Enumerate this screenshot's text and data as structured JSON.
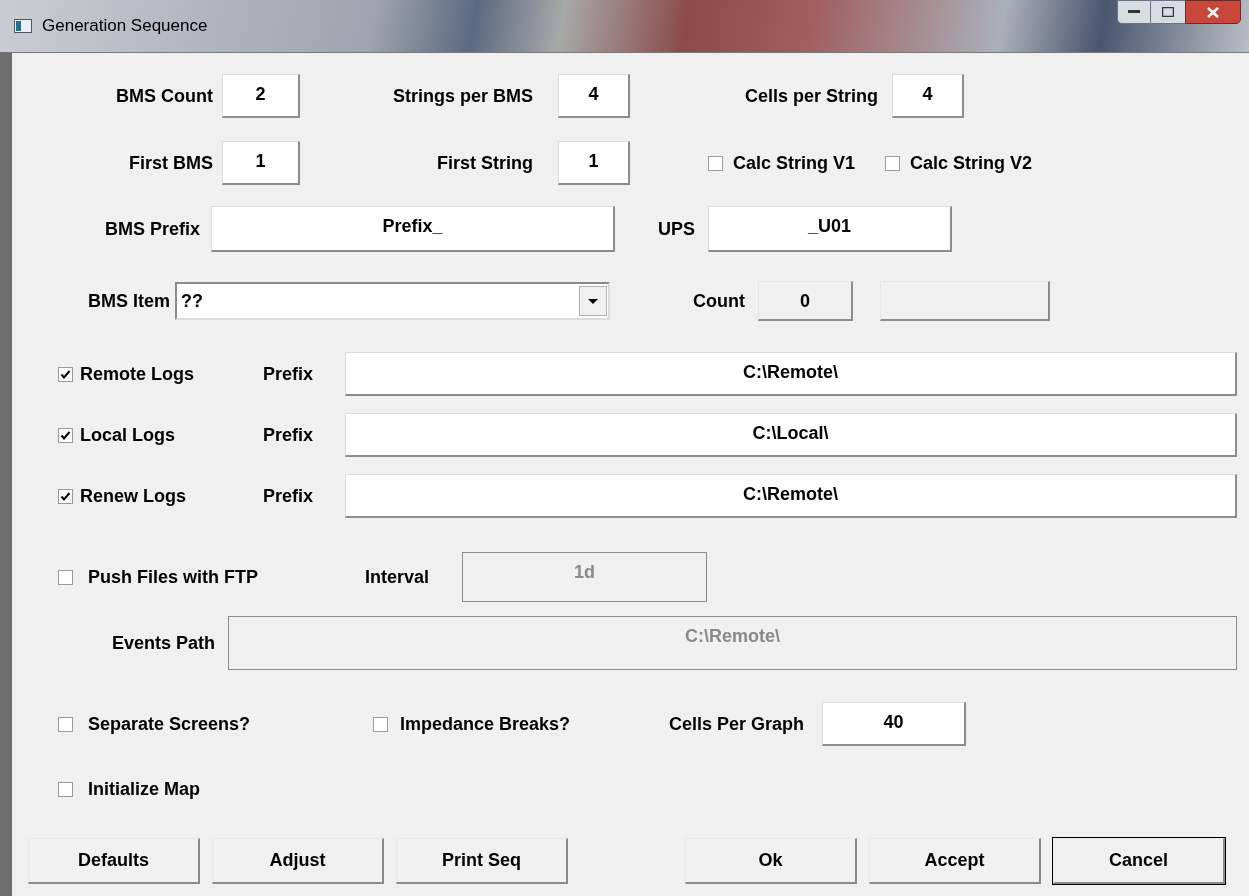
{
  "window": {
    "title": "Generation Sequence"
  },
  "counts": [
    {
      "label": "BMS Count",
      "value": "2"
    },
    {
      "label": "Strings per BMS",
      "value": "4"
    },
    {
      "label": "Cells per String",
      "value": "4"
    }
  ],
  "firsts": [
    {
      "label": "First BMS",
      "value": "1"
    },
    {
      "label": "First String",
      "value": "1"
    }
  ],
  "calc_options": [
    {
      "label": "Calc String V1",
      "checked": false
    },
    {
      "label": "Calc String V2",
      "checked": false
    }
  ],
  "bms_prefix": {
    "label": "BMS Prefix",
    "value": "Prefix_"
  },
  "ups": {
    "label": "UPS",
    "value": "_U01"
  },
  "bms_item": {
    "label": "BMS Item",
    "value": "??"
  },
  "count": {
    "label": "Count",
    "value": "0"
  },
  "logs": [
    {
      "label": "Remote Logs",
      "checked": true,
      "prefix_label": "Prefix",
      "value": "C:\\Remote\\"
    },
    {
      "label": "Local Logs",
      "checked": true,
      "prefix_label": "Prefix",
      "value": "C:\\Local\\"
    },
    {
      "label": "Renew Logs",
      "checked": true,
      "prefix_label": "Prefix",
      "value": "C:\\Remote\\"
    }
  ],
  "ftp": {
    "label": "Push Files with FTP",
    "checked": false,
    "interval_label": "Interval",
    "interval": "1d",
    "disabled": true
  },
  "events_path": {
    "label": "Events Path",
    "value": "C:\\Remote\\",
    "disabled": true
  },
  "graph_options": [
    {
      "label": "Separate Screens?",
      "checked": false
    },
    {
      "label": "Impedance Breaks?",
      "checked": false
    }
  ],
  "cells_per_graph": {
    "label": "Cells Per Graph",
    "value": "40"
  },
  "initialize_map": {
    "label": "Initialize Map",
    "checked": false
  },
  "buttons_left": [
    {
      "label": "Defaults",
      "default": false
    },
    {
      "label": "Adjust",
      "default": false
    },
    {
      "label": "Print Seq",
      "default": false
    }
  ],
  "buttons_right": [
    {
      "label": "Ok",
      "default": false
    },
    {
      "label": "Accept",
      "default": false
    },
    {
      "label": "Cancel",
      "default": true
    }
  ]
}
